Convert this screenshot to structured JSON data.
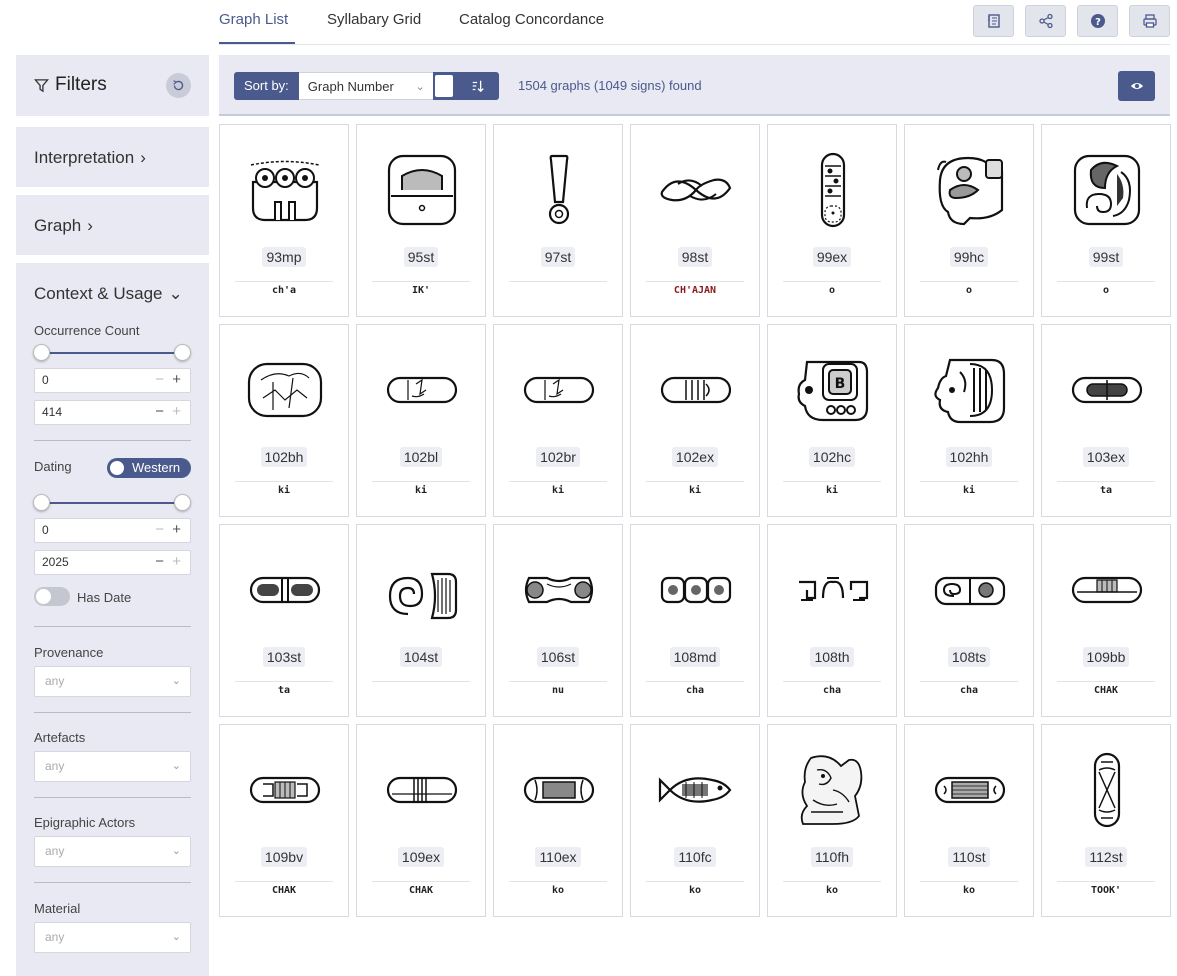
{
  "tabs": [
    {
      "label": "Graph List",
      "active": true
    },
    {
      "label": "Syllabary Grid",
      "active": false
    },
    {
      "label": "Catalog Concordance",
      "active": false
    }
  ],
  "top_actions": [
    {
      "icon": "catalog-icon"
    },
    {
      "icon": "share-icon"
    },
    {
      "icon": "help-icon"
    },
    {
      "icon": "print-icon"
    }
  ],
  "sidebar": {
    "filters_title": "Filters",
    "interpretation": "Interpretation",
    "graph": "Graph",
    "context_usage": "Context & Usage",
    "occurrence": {
      "label": "Occurrence Count",
      "min": "0",
      "max": "414"
    },
    "dating": {
      "label": "Dating",
      "toggle_label": "Western",
      "min": "0",
      "max": "2025"
    },
    "has_date": "Has Date",
    "provenance": {
      "label": "Provenance",
      "placeholder": "any"
    },
    "artefacts": {
      "label": "Artefacts",
      "placeholder": "any"
    },
    "actors": {
      "label": "Epigraphic Actors",
      "placeholder": "any"
    },
    "material": {
      "label": "Material",
      "placeholder": "any"
    }
  },
  "sortbar": {
    "label": "Sort by:",
    "selected": "Graph Number",
    "found": "1504 graphs (1049 signs) found"
  },
  "colors": {
    "accent": "#4a5a8c",
    "panel": "#e8e9f2",
    "red_reading": "#8b1a1a"
  },
  "cards": [
    {
      "num": "93mp",
      "reading": "ch'a",
      "glyph": "trio-flowers"
    },
    {
      "num": "95st",
      "reading": "IK'",
      "glyph": "square-cartouche"
    },
    {
      "num": "97st",
      "reading": "",
      "glyph": "exclamation"
    },
    {
      "num": "98st",
      "reading": "CH'AJAN",
      "glyph": "twisted-rope",
      "red": true
    },
    {
      "num": "99ex",
      "reading": "o",
      "glyph": "vertical-pod"
    },
    {
      "num": "99hc",
      "reading": "o",
      "glyph": "bird-head"
    },
    {
      "num": "99st",
      "reading": "o",
      "glyph": "cartouche-spiral"
    },
    {
      "num": "102bh",
      "reading": "ki",
      "glyph": "cracked-block"
    },
    {
      "num": "102bl",
      "reading": "ki",
      "glyph": "flat-pill"
    },
    {
      "num": "102br",
      "reading": "ki",
      "glyph": "flat-pill"
    },
    {
      "num": "102ex",
      "reading": "ki",
      "glyph": "pill-stripes"
    },
    {
      "num": "102hc",
      "reading": "ki",
      "glyph": "head-variant"
    },
    {
      "num": "102hh",
      "reading": "ki",
      "glyph": "head-profile"
    },
    {
      "num": "103ex",
      "reading": "ta",
      "glyph": "pill-dark-center"
    },
    {
      "num": "103st",
      "reading": "ta",
      "glyph": "pill-dark-ends"
    },
    {
      "num": "104st",
      "reading": "",
      "glyph": "spiral-comb"
    },
    {
      "num": "106st",
      "reading": "nu",
      "glyph": "bone"
    },
    {
      "num": "108md",
      "reading": "cha",
      "glyph": "three-beads"
    },
    {
      "num": "108th",
      "reading": "cha",
      "glyph": "scroll-meander"
    },
    {
      "num": "108ts",
      "reading": "cha",
      "glyph": "spiral-pair"
    },
    {
      "num": "109bb",
      "reading": "CHAK",
      "glyph": "pill-grid"
    },
    {
      "num": "109bv",
      "reading": "CHAK",
      "glyph": "pill-grid-ends"
    },
    {
      "num": "109ex",
      "reading": "CHAK",
      "glyph": "pill-lines"
    },
    {
      "num": "110ex",
      "reading": "ko",
      "glyph": "pill-bands"
    },
    {
      "num": "110fc",
      "reading": "ko",
      "glyph": "fish"
    },
    {
      "num": "110fh",
      "reading": "ko",
      "glyph": "seated-figure"
    },
    {
      "num": "110st",
      "reading": "ko",
      "glyph": "pill-hatched"
    },
    {
      "num": "112st",
      "reading": "TOOK'",
      "glyph": "tall-pod"
    }
  ]
}
